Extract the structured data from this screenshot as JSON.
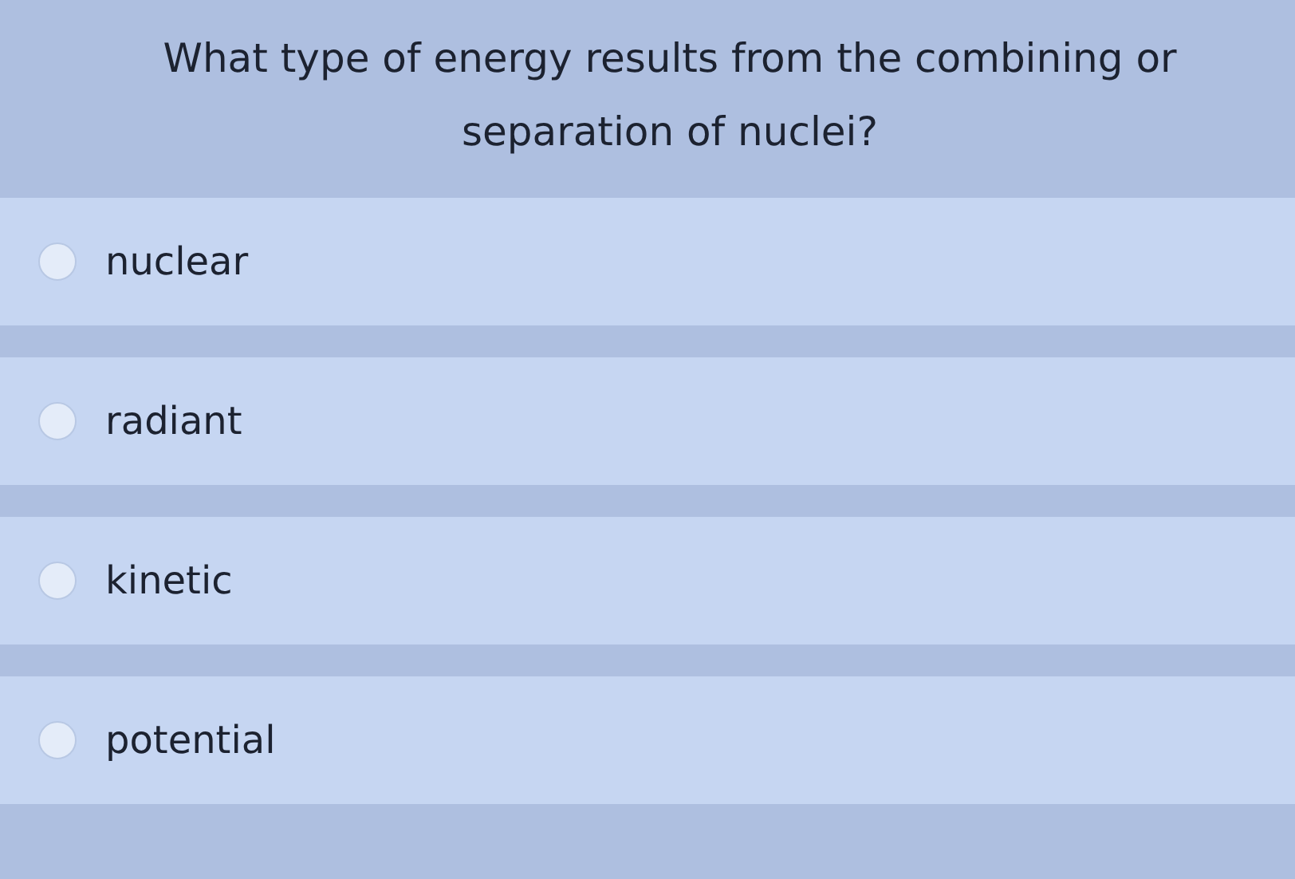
{
  "question": "What type of energy results from the combining or separation of nuclei?",
  "options": [
    {
      "label": "nuclear",
      "selected": false
    },
    {
      "label": "radiant",
      "selected": false
    },
    {
      "label": "kinetic",
      "selected": false
    },
    {
      "label": "potential",
      "selected": false
    }
  ]
}
